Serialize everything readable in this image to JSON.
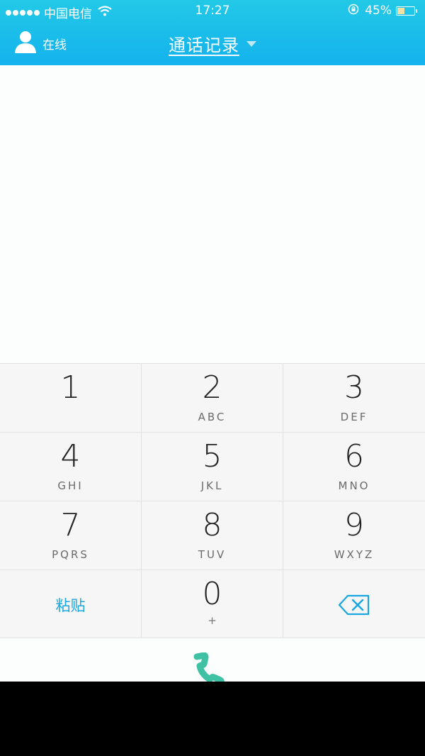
{
  "status_bar": {
    "carrier": "中国电信",
    "time": "17:27",
    "battery_percent": "45%",
    "battery_level": 0.45,
    "signal_dots": 5,
    "icons": [
      "signal-dots-icon",
      "wifi-icon",
      "orientation-lock-icon",
      "battery-icon"
    ]
  },
  "header": {
    "online_status": "在线",
    "title": "通话记录",
    "colors": {
      "gradient_top": "#22c9e6",
      "gradient_bottom": "#14b2ee"
    }
  },
  "keypad": {
    "keys": [
      {
        "digit": "1",
        "letters": ""
      },
      {
        "digit": "2",
        "letters": "ABC"
      },
      {
        "digit": "3",
        "letters": "DEF"
      },
      {
        "digit": "4",
        "letters": "GHI"
      },
      {
        "digit": "5",
        "letters": "JKL"
      },
      {
        "digit": "6",
        "letters": "MNO"
      },
      {
        "digit": "7",
        "letters": "PQRS"
      },
      {
        "digit": "8",
        "letters": "TUV"
      },
      {
        "digit": "9",
        "letters": "WXYZ"
      }
    ],
    "paste_label": "粘贴",
    "zero": {
      "digit": "0",
      "letters": "+"
    },
    "accent_color": "#1aa6e0",
    "call_color": "#3fc1a3"
  }
}
